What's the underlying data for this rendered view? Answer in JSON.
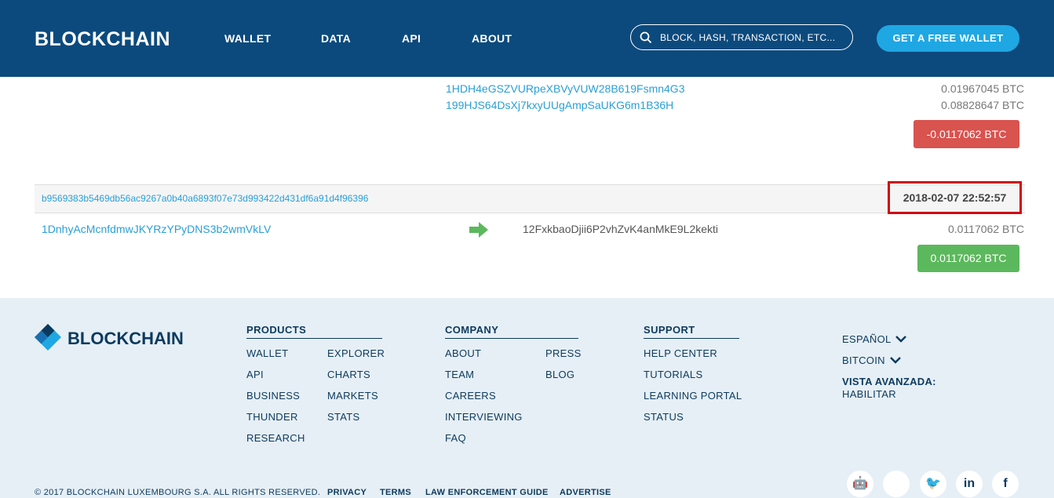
{
  "header": {
    "logo": "BLOCKCHAIN",
    "nav": [
      "WALLET",
      "DATA",
      "API",
      "ABOUT"
    ],
    "search_placeholder": "BLOCK, HASH, TRANSACTION, ETC...",
    "cta": "GET A FREE WALLET"
  },
  "prev_tx": {
    "outputs": [
      {
        "address": "1HDH4eGSZVURpeXBVyVUW28B619Fsmn4G3",
        "amount": "0.01967045 BTC"
      },
      {
        "address": "199HJS64DsXj7kxyUUgAmpSaUKG6m1B36H",
        "amount": "0.08828647 BTC"
      }
    ],
    "total": "-0.0117062 BTC"
  },
  "tx": {
    "hash": "b9569383b5469db56ac9267a0b40a6893f07e73d993422d431df6a91d4f96396",
    "time": "2018-02-07 22:52:57",
    "from": "1DnhyAcMcnfdmwJKYRzYPyDNS3b2wmVkLV",
    "to": "12FxkbaoDjii6P2vhZvK4anMkE9L2kekti",
    "amount": "0.0117062 BTC",
    "total": "0.0117062 BTC"
  },
  "footer": {
    "logo": "BLOCKCHAIN",
    "products": {
      "title": "PRODUCTS",
      "links": [
        "WALLET",
        "API",
        "BUSINESS",
        "THUNDER",
        "RESEARCH",
        "EXPLORER",
        "CHARTS",
        "MARKETS",
        "STATS"
      ]
    },
    "company": {
      "title": "COMPANY",
      "links": [
        "ABOUT",
        "TEAM",
        "CAREERS",
        "INTERVIEWING",
        "FAQ",
        "PRESS",
        "BLOG"
      ]
    },
    "support": {
      "title": "SUPPORT",
      "links": [
        "HELP CENTER",
        "TUTORIALS",
        "LEARNING PORTAL",
        "STATUS"
      ]
    },
    "language": "ESPAÑOL",
    "currency": "BITCOIN",
    "advanced_label": "VISTA AVANZADA:",
    "advanced_value": "HABILITAR",
    "copyright": "© 2017 BLOCKCHAIN LUXEMBOURG S.A. ALL RIGHTS RESERVED.",
    "legal": [
      "PRIVACY",
      "TERMS",
      "LAW ENFORCEMENT GUIDE",
      "ADVERTISE"
    ],
    "social": [
      "android-icon",
      "apple-icon",
      "twitter-icon",
      "linkedin-icon",
      "facebook-icon"
    ],
    "social_glyphs": [
      "🤖",
      "",
      "🐦",
      "in",
      "f"
    ]
  },
  "colors": {
    "header_bg": "#0c4a7d",
    "accent": "#1fa7e3",
    "link": "#2a9fd6",
    "red": "#d9534f",
    "green": "#5cb85c",
    "highlight": "#d0021b",
    "footer_bg": "#e6eff5"
  }
}
